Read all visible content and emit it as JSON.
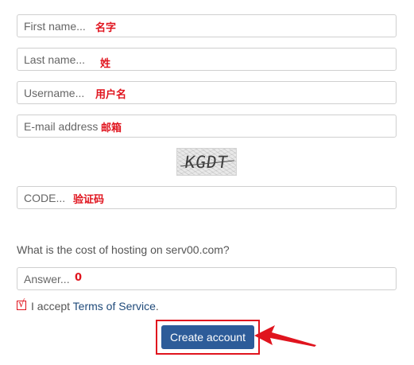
{
  "form": {
    "first_name": {
      "placeholder": "First name...",
      "annotation": "名字"
    },
    "last_name": {
      "placeholder": "Last name...",
      "annotation": "姓"
    },
    "username": {
      "placeholder": "Username...",
      "annotation": "用户名"
    },
    "email": {
      "placeholder": "E-mail address",
      "annotation": "邮箱"
    },
    "captcha_image_text": "KGDT",
    "captcha_code": {
      "placeholder": "CODE...",
      "annotation": "验证码"
    },
    "question": "What is the cost of hosting on serv00.com?",
    "answer": {
      "placeholder": "Answer...",
      "annotation": "0"
    },
    "accept": {
      "checked_mark": "√",
      "prefix": "I accept ",
      "link": "Terms of Service",
      "suffix": "."
    },
    "submit_label": "Create account"
  },
  "colors": {
    "annotation": "#e0141e",
    "button": "#2d5c99",
    "link": "#1f4a7a"
  }
}
